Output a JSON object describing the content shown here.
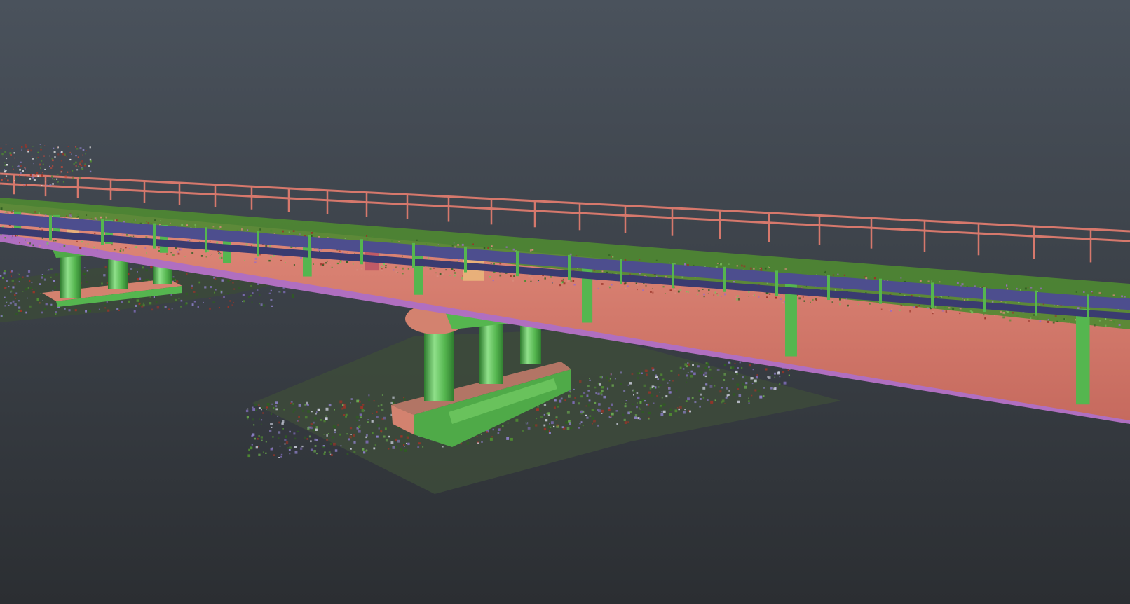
{
  "viewport": {
    "type": "3d-point-cloud-view",
    "subject": "bridge",
    "background_top_color": "#4a525c",
    "background_bottom_color": "#2b2e32"
  },
  "palette": {
    "deck": "#d9776a",
    "deck_shade": "#c66a5e",
    "deck_underside": "#b06fc0",
    "pillar_light": "#8fe08a",
    "pillar_mid": "#55b64f",
    "pillar_dark": "#2f7d2f",
    "guardrail": "#4d4e8e",
    "guardrail_dark": "#3a3b70",
    "railing": "#d6786c",
    "vegetation": "#4f8a32",
    "vegetation_dark": "#2f5d22",
    "rubble_red": "#9a3428",
    "rubble_purple": "#7a6ab0",
    "pier_base": "#d3826f"
  }
}
